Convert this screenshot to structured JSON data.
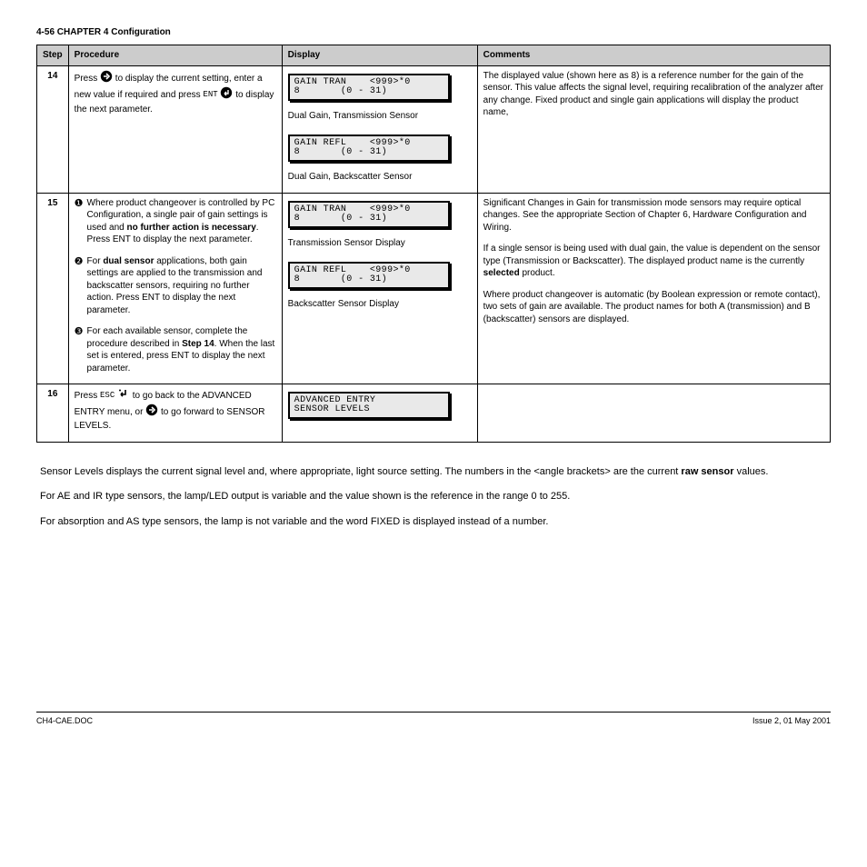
{
  "pageHeader": "4-56   CHAPTER 4  Configuration",
  "table": {
    "headers": [
      "Step",
      "Procedure",
      "Display",
      "Comments"
    ],
    "rows": [
      {
        "step": "14",
        "procedure_pre": "Press ",
        "procedure_icon1": "right-arrow-icon",
        "procedure_mid": " to display the current setting, enter a new value if required and press ",
        "procedure_icon2_label": "ENT",
        "procedure_icon2": "enter-icon",
        "procedure_post": " to display the next parameter.",
        "lcd_a_line1": "GAIN TRAN    <999>*0",
        "lcd_a_line2": "8       (0 - 31)",
        "lcd_a_caption": "Dual Gain,  Transmission Sensor",
        "lcd_b_line1": "GAIN REFL    <999>*0",
        "lcd_b_line2": "8       (0 - 31)",
        "lcd_b_caption": "Dual Gain, Backscatter Sensor",
        "comments": "The displayed value (shown here as 8) is a reference number for the gain of the sensor. This value affects the signal level, requiring recalibration of the analyzer after any change. Fixed product and  single gain applications will display the product name,"
      },
      {
        "step": "15",
        "proc_items": [
          {
            "num": "❶",
            "text_pre": "Where product changeover is controlled by PC Configuration, a single pair of gain settings is used and ",
            "text_bold": "no further action is necessary",
            "text_post": ". Press ENT to display the next parameter."
          },
          {
            "num": "❷",
            "text_pre": "For ",
            "text_bold": "dual sensor",
            "text_post": " applications, both gain settings are applied to the transmission and backscatter sensors, requiring no further action. Press ENT to display the next parameter."
          },
          {
            "num": "❸",
            "text_pre": "For each available sensor, complete the procedure described in ",
            "text_bold": "Step 14",
            "text_post": ". When the last set is entered, press ENT to display the next parameter."
          }
        ],
        "lcd_a_line1": "GAIN TRAN    <999>*0",
        "lcd_a_line2": "8       (0 - 31)",
        "lcd_a_caption": "Transmission Sensor Display",
        "lcd_b_line1": "GAIN REFL    <999>*0",
        "lcd_b_line2": "8       (0 - 31)",
        "lcd_b_caption": "Backscatter Sensor Display",
        "comments_1": "Significant Changes in Gain for transmission mode sensors may require optical changes. See the appropriate Section of Chapter 6, Hardware Configuration and Wiring.",
        "comments_2_pre": "If a single sensor is being used with dual gain, the value is dependent on the sensor type (Transmission or Backscatter). The displayed product name is the currently ",
        "comments_2_bold": "selected",
        "comments_2_post": " product.",
        "comments_3": "Where product changeover is automatic (by Boolean expression or remote contact), two sets of gain are available. The product names for both A (transmission) and B (backscatter) sensors are displayed."
      },
      {
        "step": "16",
        "procedure_pre": "Press ",
        "procedure_label1": "ESC",
        "procedure_icon1": "esc-icon",
        "procedure_mid": " to go back to the ADVANCED ENTRY menu, or ",
        "procedure_icon2": "right-arrow-icon",
        "procedure_post": " to go forward to SENSOR LEVELS.",
        "lcd_line1": "ADVANCED ENTRY",
        "lcd_line2": "SENSOR LEVELS"
      }
    ]
  },
  "body1_pre": "Sensor Levels displays the current signal level and, where appropriate, light source setting. The numbers in the <angle brackets> are the current ",
  "body1_bold": "raw sensor",
  "body1_post": " values.",
  "body2": "For AE and IR type sensors, the lamp/LED output is variable and the value shown is the reference in the range 0 to 255.",
  "body3": "For absorption and AS type sensors, the lamp is not variable and the word FIXED is displayed instead of a number.",
  "footerLeft": "CH4-CAE.DOC",
  "footerRight": "Issue 2,  01 May 2001"
}
